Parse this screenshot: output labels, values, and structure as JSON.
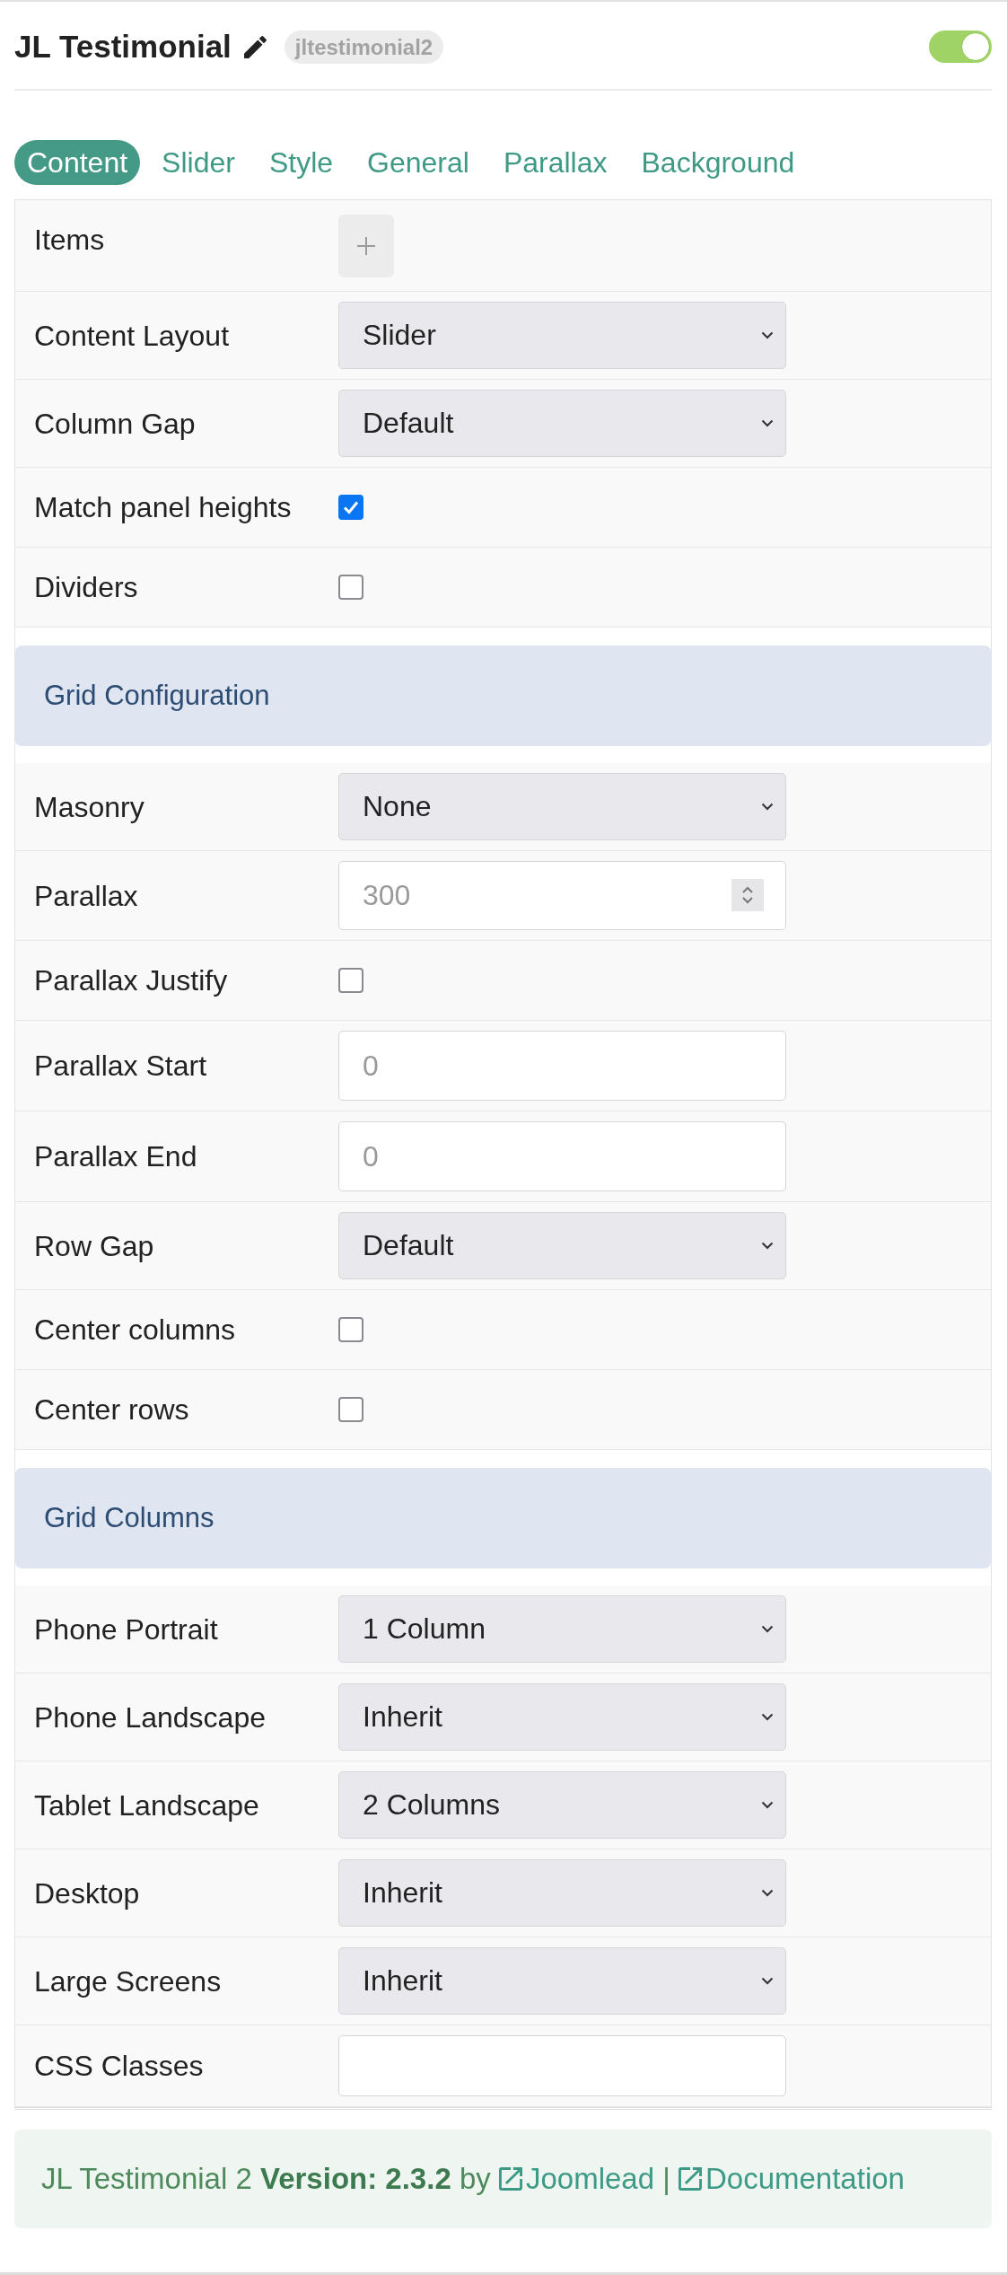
{
  "header": {
    "title": "JL Testimonial",
    "badge": "jltestimonial2",
    "enabled": true
  },
  "tabs": [
    {
      "label": "Content",
      "selected": true
    },
    {
      "label": "Slider",
      "selected": false
    },
    {
      "label": "Style",
      "selected": false
    },
    {
      "label": "General",
      "selected": false
    },
    {
      "label": "Parallax",
      "selected": false
    },
    {
      "label": "Background",
      "selected": false
    }
  ],
  "form": {
    "sections": [
      {
        "rows": [
          {
            "label": "Items",
            "kind": "add"
          },
          {
            "label": "Content Layout",
            "kind": "select",
            "value": "Slider"
          },
          {
            "label": "Column Gap",
            "kind": "select",
            "value": "Default"
          },
          {
            "label": "Match panel heights",
            "kind": "checkbox",
            "checked": true
          },
          {
            "label": "Dividers",
            "kind": "checkbox",
            "checked": false
          }
        ]
      },
      {
        "heading": "Grid Configuration",
        "rows": [
          {
            "label": "Masonry",
            "kind": "select",
            "value": "None"
          },
          {
            "label": "Parallax",
            "kind": "spinbox",
            "placeholder": "300"
          },
          {
            "label": "Parallax Justify",
            "kind": "checkbox",
            "checked": false
          },
          {
            "label": "Parallax Start",
            "kind": "number",
            "placeholder": "0"
          },
          {
            "label": "Parallax End",
            "kind": "number",
            "placeholder": "0"
          },
          {
            "label": "Row Gap",
            "kind": "select",
            "value": "Default"
          },
          {
            "label": "Center columns",
            "kind": "checkbox",
            "checked": false
          },
          {
            "label": "Center rows",
            "kind": "checkbox",
            "checked": false
          }
        ]
      },
      {
        "heading": "Grid Columns",
        "rows": [
          {
            "label": "Phone Portrait",
            "kind": "select",
            "value": "1 Column"
          },
          {
            "label": "Phone Landscape",
            "kind": "select",
            "value": "Inherit"
          },
          {
            "label": "Tablet Landscape",
            "kind": "select",
            "value": "2 Columns"
          },
          {
            "label": "Desktop",
            "kind": "select",
            "value": "Inherit"
          },
          {
            "label": "Large Screens",
            "kind": "select",
            "value": "Inherit"
          },
          {
            "label": "CSS Classes",
            "kind": "text"
          }
        ]
      }
    ]
  },
  "footer": {
    "text": "JL Testimonial 2 **Version: 2.3.2** by",
    "links": [
      {
        "label": "Joomlead"
      },
      {
        "label": "Documentation"
      }
    ],
    "separator": "|"
  }
}
